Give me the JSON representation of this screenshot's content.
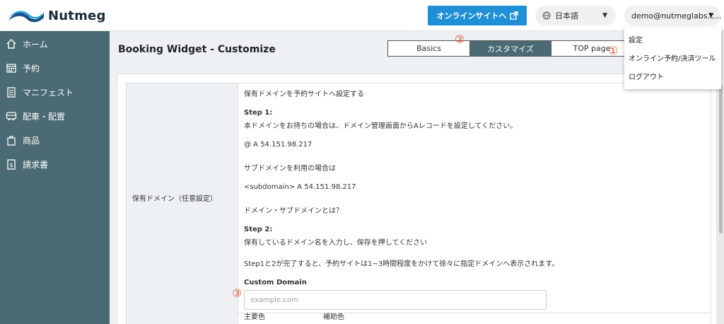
{
  "header": {
    "logo_text": "Nutmeg",
    "online_site_label": "オンラインサイトへ",
    "language_value": "日本語",
    "user_value": "demo@nutmeglabs.c..."
  },
  "user_menu": {
    "items": [
      "設定",
      "オンライン予約/決済ツール",
      "ログアウト"
    ]
  },
  "sidebar": {
    "items": [
      {
        "label": "ホーム",
        "icon": "home-icon"
      },
      {
        "label": "予約",
        "icon": "calendar-icon"
      },
      {
        "label": "マニフェスト",
        "icon": "clipboard-icon"
      },
      {
        "label": "配車・配置",
        "icon": "bus-icon"
      },
      {
        "label": "商品",
        "icon": "bag-icon"
      },
      {
        "label": "請求書",
        "icon": "invoice-icon"
      }
    ]
  },
  "page": {
    "title": "Booking Widget - Customize",
    "tabs": [
      "Basics",
      "カスタマイズ",
      "TOP page"
    ],
    "active_tab": "カスタマイズ"
  },
  "domain_section": {
    "label": "保有ドメイン（任意設定）",
    "intro": "保有ドメインを予約サイトへ設定する",
    "step1_title": "Step 1:",
    "step1_text": "本ドメインをお持ちの場合は、ドメイン管理画面からAレコードを設定してください。",
    "a_record": "@ A 54.151.98.217",
    "subdomain_intro": "サブドメインを利用の場合は",
    "subdomain_record": "<subdomain> A 54.151.98.217",
    "what_is": "ドメイン・サブドメインとは？",
    "step2_title": "Step 2:",
    "step2_text": "保有しているドメイン名を入力し、保存を押してください",
    "completion_note": "Step1と2が完了すると、予約サイトは1~3時間程度をかけて徐々に指定ドメインへ表示されます。",
    "custom_domain_label": "Custom Domain",
    "custom_domain_placeholder": "example.com"
  },
  "color_section": {
    "primary": "主要色",
    "secondary": "補助色"
  },
  "annotations": {
    "one": "①",
    "two": "②",
    "three": "③"
  },
  "colors": {
    "sidebar": "#4a6a74",
    "primary_button": "#1f8fd6",
    "annotation": "#e0562e"
  }
}
